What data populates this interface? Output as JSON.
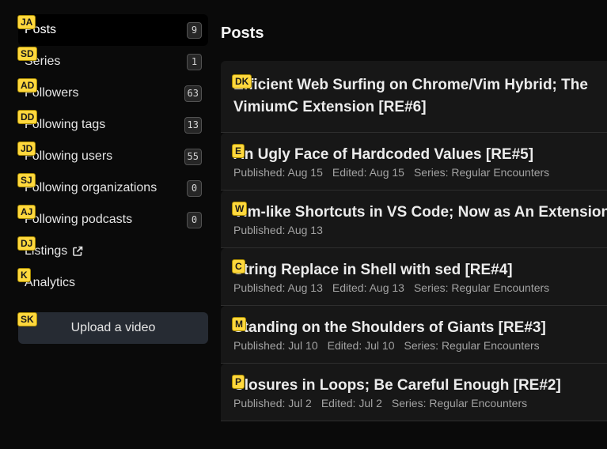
{
  "sidebar": {
    "items": [
      {
        "label": "Posts",
        "count": "9",
        "hint": "JA",
        "active": true
      },
      {
        "label": "Series",
        "count": "1",
        "hint": "SD"
      },
      {
        "label": "Followers",
        "count": "63",
        "hint": "AD"
      },
      {
        "label": "Following tags",
        "count": "13",
        "hint": "DD"
      },
      {
        "label": "Following users",
        "count": "55",
        "hint": "JD"
      },
      {
        "label": "Following organizations",
        "count": "0",
        "hint": "SJ"
      },
      {
        "label": "Following podcasts",
        "count": "0",
        "hint": "AJ"
      },
      {
        "label": "Listings",
        "hint": "DJ",
        "icon": "external-link-icon"
      },
      {
        "label": "Analytics",
        "hint": "K"
      }
    ],
    "upload": {
      "label": "Upload a video",
      "hint": "SK"
    }
  },
  "main": {
    "heading": "Posts",
    "posts": [
      {
        "title": "Efficient Web Surfing on Chrome/Vim Hybrid; The VimiumC Extension [RE#6]",
        "hint": "DK"
      },
      {
        "title": "An Ugly Face of Hardcoded Values [RE#5]",
        "hint": "E",
        "published": "Published: Aug 15",
        "edited": "Edited: Aug 15",
        "series": "Series: Regular Encounters"
      },
      {
        "title": "Vim-like Shortcuts in VS Code; Now as An Extension",
        "hint": "W",
        "published": "Published: Aug 13"
      },
      {
        "title": "String Replace in Shell with sed [RE#4]",
        "hint": "C",
        "published": "Published: Aug 13",
        "edited": "Edited: Aug 13",
        "series": "Series: Regular Encounters"
      },
      {
        "title": "Standing on the Shoulders of Giants [RE#3]",
        "hint": "M",
        "published": "Published: Jul 10",
        "edited": "Edited: Jul 10",
        "series": "Series: Regular Encounters"
      },
      {
        "title": "Closures in Loops; Be Careful Enough [RE#2]",
        "hint": "P",
        "published": "Published: Jul 2",
        "edited": "Edited: Jul 2",
        "series": "Series: Regular Encounters"
      }
    ]
  },
  "colors": {
    "background": "#0a0a0a",
    "card": "#171717",
    "hint_badge": "#ffd83d",
    "upload_button": "#262b33"
  }
}
